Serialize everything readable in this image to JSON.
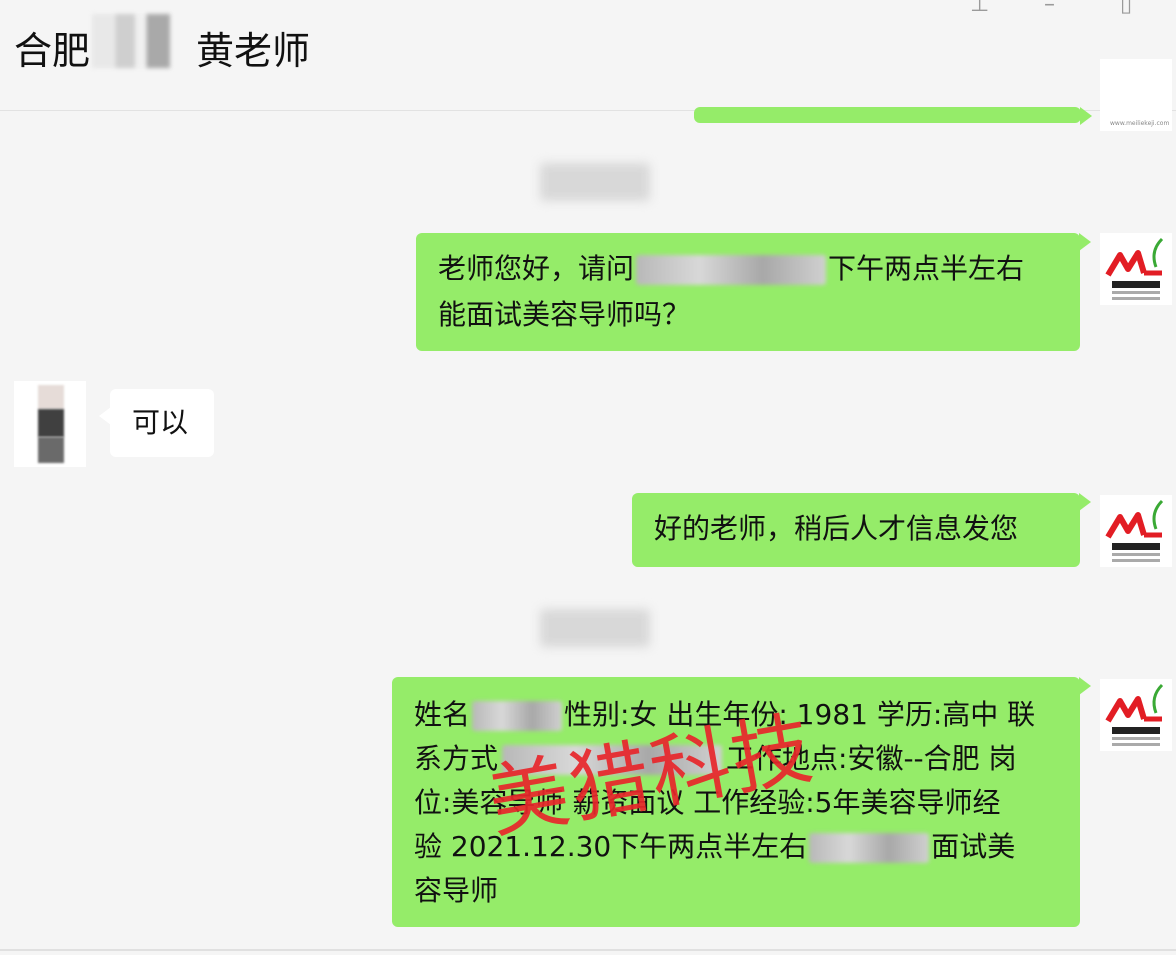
{
  "header": {
    "title_left": "合肥",
    "title_right": "黄老师",
    "pin_icon": "pin-icon",
    "minimize_icon": "minimize-icon",
    "maximize_icon": "maximize-icon"
  },
  "messages": {
    "msg1": {
      "text_before": "老师您好，请问",
      "text_after": "下午两点半左右",
      "line2": "能面试美容导师吗？"
    },
    "msg2": {
      "text": "可以"
    },
    "msg3": {
      "text": "好的老师，稍后人才信息发您"
    },
    "msg4": {
      "l1a": "姓名",
      "l1b": "性别:女 出生年份: 1981 学历:高中 联",
      "l2a": "系方式",
      "l2b": "工作地点:安徽--合肥 岗",
      "l3": "位:美容导师 薪资面议 工作经验:5年美容导师经",
      "l4a": "验 2021.12.30下午两点半左右",
      "l4b": "面试美",
      "l5": "容导师"
    }
  },
  "watermark": "美猎科技",
  "colors": {
    "bubble_green": "#95ec69",
    "bubble_white": "#ffffff",
    "background": "#f5f5f5",
    "watermark_red": "#e8262b",
    "logo_red": "#e21d24",
    "logo_green": "#3aa935"
  }
}
